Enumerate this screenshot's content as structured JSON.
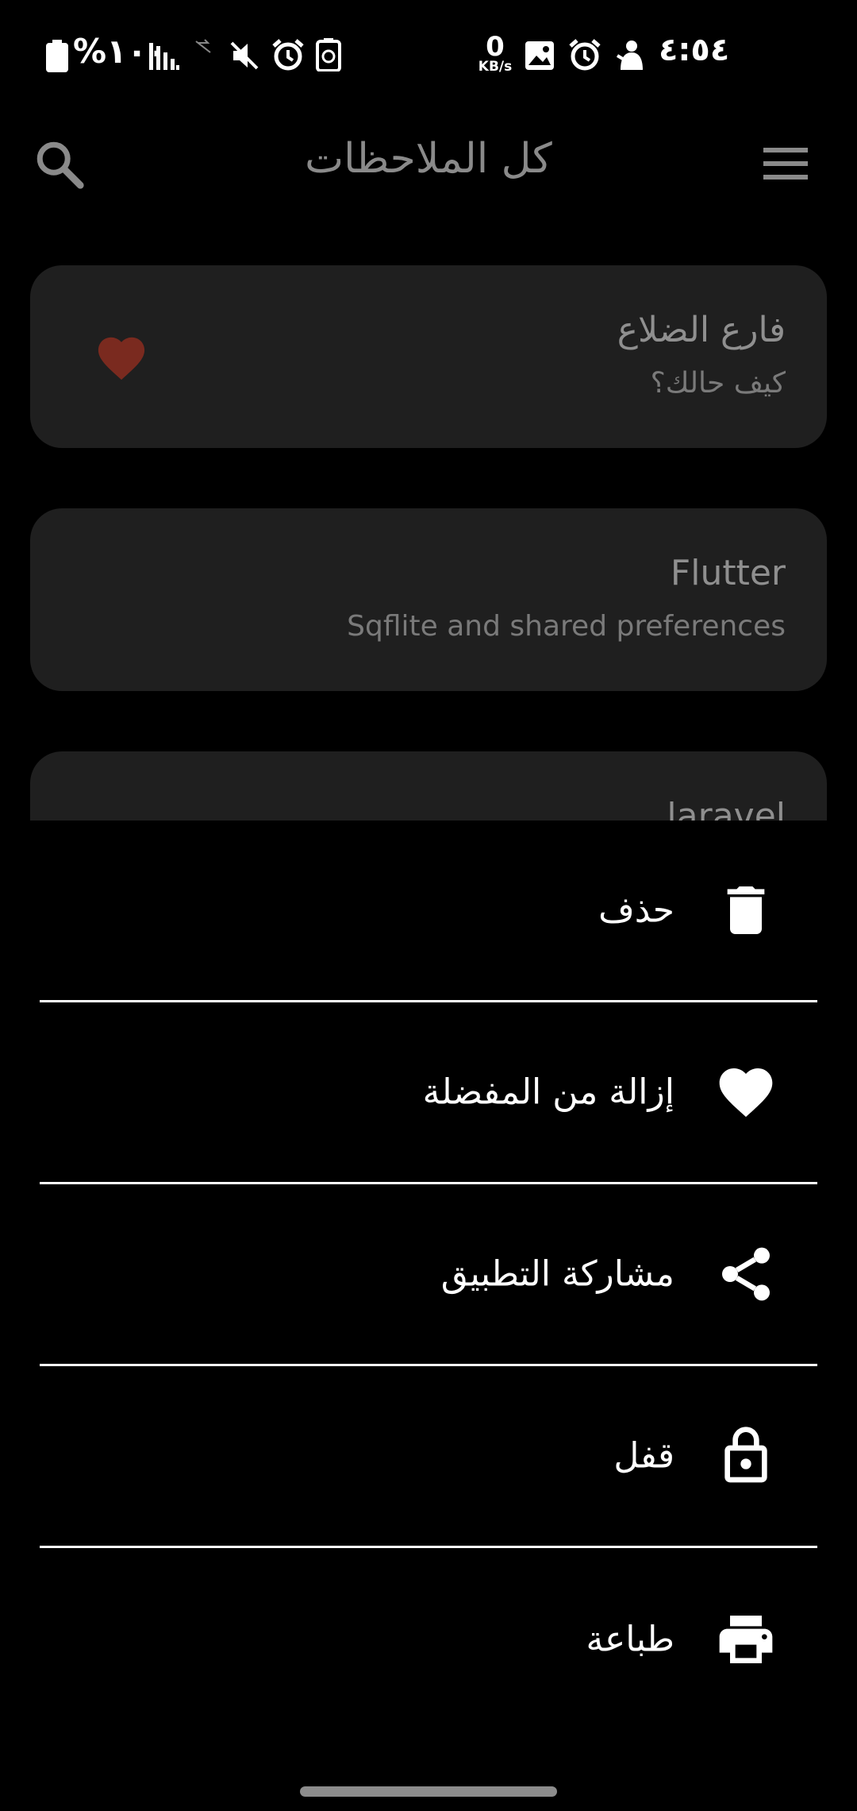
{
  "status_bar": {
    "battery_percent": "%١٠٠",
    "net_speed_value": "0",
    "net_speed_unit": "KB/s",
    "time": "٤:٥٤",
    "icons": [
      "battery-icon",
      "signal-icon",
      "no-data-icon",
      "mute-icon",
      "alarm-icon",
      "recycle-icon",
      "gallery-icon",
      "alarm-icon",
      "app-notification-icon"
    ]
  },
  "app_bar": {
    "title": "كل الملاحظات",
    "search_icon": "search-icon",
    "menu_icon": "menu-icon"
  },
  "notes": [
    {
      "title": "فارع الضلاع",
      "body": "كيف حالك؟",
      "favorite": true
    },
    {
      "title": "Flutter",
      "body": "Sqflite and shared preferences",
      "favorite": false
    },
    {
      "title": "laravel",
      "body": "",
      "favorite": true
    }
  ],
  "bottom_sheet": {
    "items": [
      {
        "label": "حذف",
        "icon": "trash-icon"
      },
      {
        "label": "إزالة من المفضلة",
        "icon": "heart-icon"
      },
      {
        "label": "مشاركة التطبيق",
        "icon": "share-icon"
      },
      {
        "label": "قفل",
        "icon": "lock-icon"
      },
      {
        "label": "طباعة",
        "icon": "print-icon"
      }
    ]
  },
  "colors": {
    "background": "#000000",
    "card": "#1f1f1f",
    "favorite_heart": "#7a2a1f",
    "sheet_text": "#ffffff"
  }
}
